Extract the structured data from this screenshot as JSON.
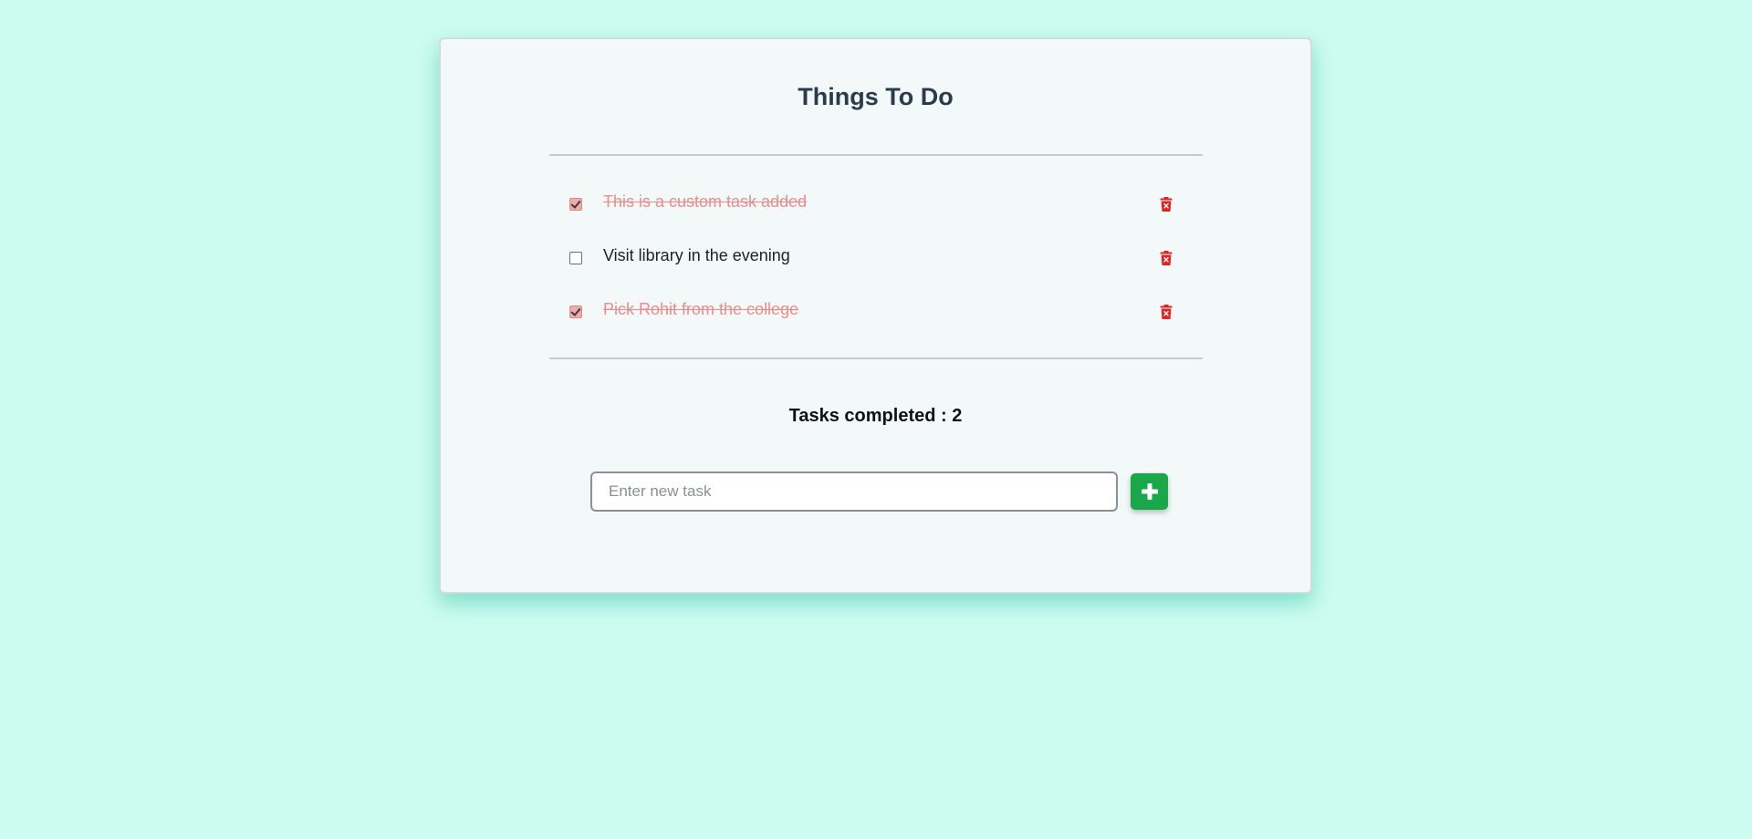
{
  "app": {
    "title": "Things To Do"
  },
  "tasks": [
    {
      "text": "This is a custom task added",
      "completed": true
    },
    {
      "text": "Visit library in the evening",
      "completed": false
    },
    {
      "text": "Pick Rohit from the college",
      "completed": true
    }
  ],
  "summary": {
    "text": "Tasks completed : 2"
  },
  "new_task": {
    "placeholder": "Enter new task",
    "value": ""
  },
  "icons": {
    "delete": "trash-icon",
    "add": "plus-icon",
    "check": "checkmark-icon"
  },
  "colors": {
    "background": "#ccfbef",
    "card": "#f3f9f9",
    "completed_text": "#f08a8a",
    "delete_icon": "#e02424",
    "add_button": "#18a84a"
  }
}
